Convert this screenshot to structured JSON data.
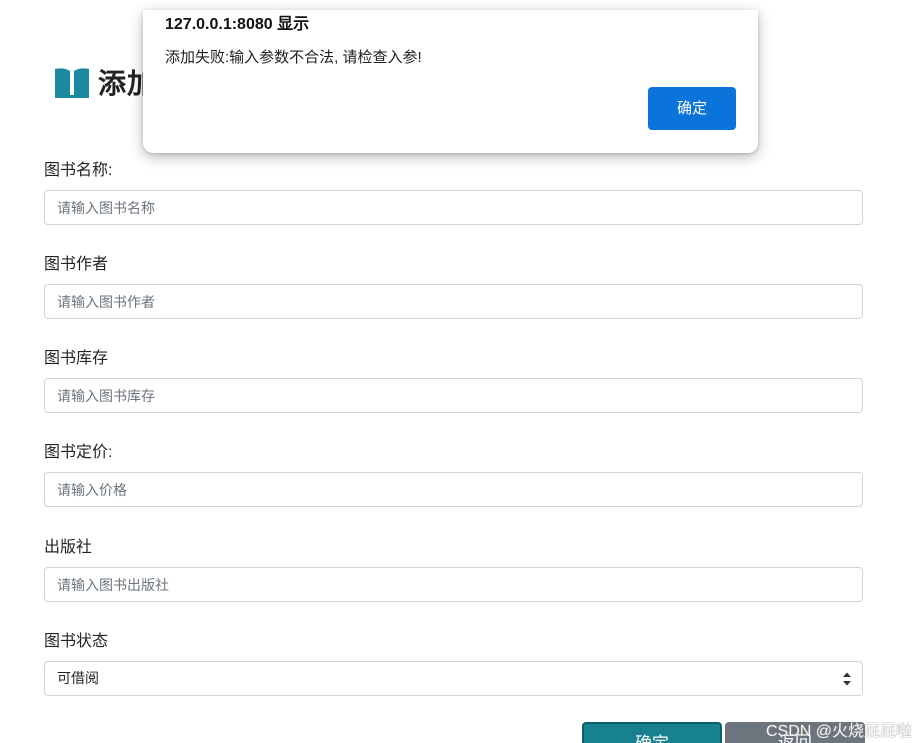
{
  "page": {
    "title": "添加"
  },
  "dialog": {
    "origin": "127.0.0.1:8080 显示",
    "message": "添加失败:输入参数不合法, 请检查入参!",
    "ok_label": "确定"
  },
  "form": {
    "fields": [
      {
        "label": "图书名称:",
        "placeholder": "请输入图书名称",
        "value": ""
      },
      {
        "label": "图书作者",
        "placeholder": "请输入图书作者",
        "value": ""
      },
      {
        "label": "图书库存",
        "placeholder": "请输入图书库存",
        "value": ""
      },
      {
        "label": "图书定价:",
        "placeholder": "请输入价格",
        "value": ""
      },
      {
        "label": "出版社",
        "placeholder": "请输入图书出版社",
        "value": ""
      }
    ],
    "status": {
      "label": "图书状态",
      "selected": "可借阅"
    },
    "buttons": {
      "confirm_label": "确定",
      "back_label": "返回"
    }
  },
  "watermark": "CSDN @火烧屁屁啦",
  "colors": {
    "confirm_button": "#17818f",
    "back_button": "#6c757d",
    "dialog_ok": "#0a74da",
    "book_icon": "#1b8aa0"
  },
  "icons": {
    "title_icon": "open-book-icon",
    "select_arrow": "sort-arrows-icon"
  }
}
